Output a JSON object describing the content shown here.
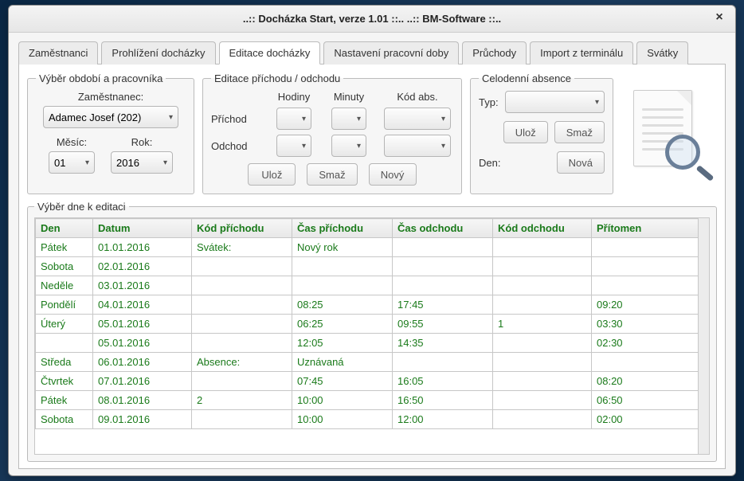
{
  "window": {
    "title": "..:: Docházka Start, verze 1.01 ::..      ..:: BM-Software ::.."
  },
  "tabs": {
    "zamestnanci": "Zaměstnanci",
    "prohlizeni": "Prohlížení docházky",
    "editace": "Editace docházky",
    "nastaveni": "Nastavení pracovní doby",
    "pruchody": "Průchody",
    "import": "Import z terminálu",
    "svatky": "Svátky"
  },
  "period": {
    "legend": "Výběr období a pracovníka",
    "employee_label": "Zaměstnanec:",
    "employee_value": "Adamec Josef (202)",
    "month_label": "Měsíc:",
    "month_value": "01",
    "year_label": "Rok:",
    "year_value": "2016"
  },
  "edit": {
    "legend": "Editace příchodu / odchodu",
    "col_hours": "Hodiny",
    "col_minutes": "Minuty",
    "col_code": "Kód abs.",
    "row_arrival": "Příchod",
    "row_departure": "Odchod",
    "btn_save": "Ulož",
    "btn_delete": "Smaž",
    "btn_new": "Nový"
  },
  "absence": {
    "legend": "Celodenní absence",
    "type_label": "Typ:",
    "btn_save": "Ulož",
    "btn_delete": "Smaž",
    "day_label": "Den:",
    "btn_new": "Nová"
  },
  "table": {
    "legend": "Výběr dne k editaci",
    "headers": {
      "den": "Den",
      "datum": "Datum",
      "kod_prichodu": "Kód příchodu",
      "cas_prichodu": "Čas příchodu",
      "cas_odchodu": "Čas odchodu",
      "kod_odchodu": "Kód odchodu",
      "pritomen": "Přítomen"
    },
    "rows": [
      {
        "den": "Pátek",
        "datum": "01.01.2016",
        "kodp": "Svátek:",
        "casp": "Nový rok",
        "caso": "",
        "kodo": "",
        "prit": ""
      },
      {
        "den": "Sobota",
        "datum": "02.01.2016",
        "kodp": "",
        "casp": "",
        "caso": "",
        "kodo": "",
        "prit": ""
      },
      {
        "den": "Neděle",
        "datum": "03.01.2016",
        "kodp": "",
        "casp": "",
        "caso": "",
        "kodo": "",
        "prit": ""
      },
      {
        "den": "Pondělí",
        "datum": "04.01.2016",
        "kodp": "",
        "casp": "08:25",
        "caso": "17:45",
        "kodo": "",
        "prit": "09:20"
      },
      {
        "den": "Úterý",
        "datum": "05.01.2016",
        "kodp": "",
        "casp": "06:25",
        "caso": "09:55",
        "kodo": "1",
        "prit": "03:30"
      },
      {
        "den": "",
        "datum": "05.01.2016",
        "kodp": "",
        "casp": "12:05",
        "caso": "14:35",
        "kodo": "",
        "prit": "02:30"
      },
      {
        "den": "Středa",
        "datum": "06.01.2016",
        "kodp": "Absence:",
        "casp": "Uznávaná",
        "caso": "",
        "kodo": "",
        "prit": ""
      },
      {
        "den": "Čtvrtek",
        "datum": "07.01.2016",
        "kodp": "",
        "casp": "07:45",
        "caso": "16:05",
        "kodo": "",
        "prit": "08:20"
      },
      {
        "den": "Pátek",
        "datum": "08.01.2016",
        "kodp": "2",
        "casp": "10:00",
        "caso": "16:50",
        "kodo": "",
        "prit": "06:50"
      },
      {
        "den": "Sobota",
        "datum": "09.01.2016",
        "kodp": "",
        "casp": "10:00",
        "caso": "12:00",
        "kodo": "",
        "prit": "02:00"
      }
    ]
  }
}
